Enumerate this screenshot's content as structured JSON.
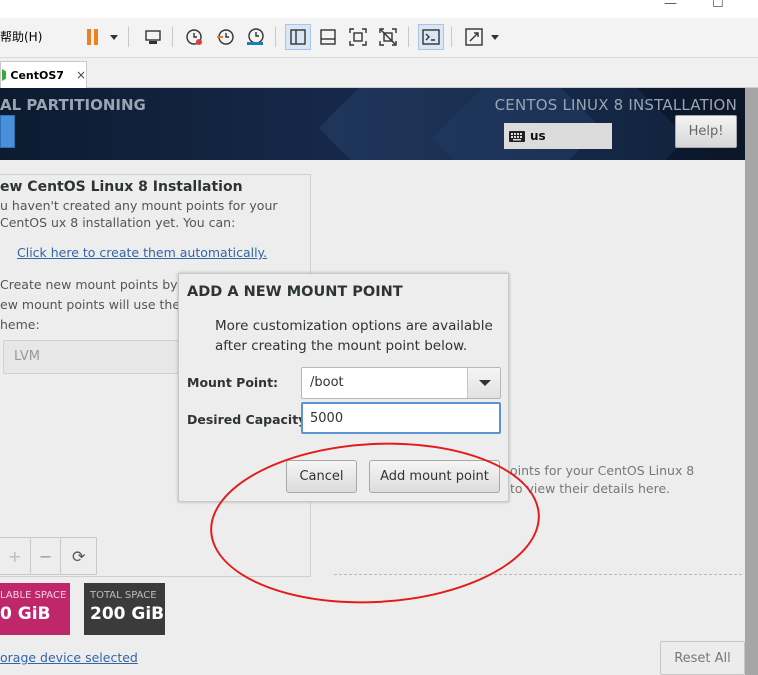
{
  "host": {
    "help_menu": "帮助(H)",
    "tab": {
      "label": "CentOS7",
      "close": "×"
    },
    "window_controls": {
      "minimize": "—",
      "maximize": "☐"
    }
  },
  "vm_header": {
    "left_title": "AL PARTITIONING",
    "right_title": "CENTOS LINUX 8 INSTALLATION",
    "keyboard": "us",
    "help_button": "Help!"
  },
  "left_panel": {
    "title": "ew CentOS Linux 8 Installation",
    "message": "u haven't created any mount points for your CentOS ux 8 installation yet.  You can:",
    "auto_link": "Click here to create them automatically.",
    "message2_line1": "Create new mount points by cl",
    "message2_line2": "ew mount points will use the fo",
    "message2_line3": "heme:",
    "scheme": "LVM",
    "add_symbol": "+",
    "remove_symbol": "−",
    "refresh_symbol": "⟳"
  },
  "space": {
    "available_label": "LABLE SPACE",
    "available_value": "0 GiB",
    "total_label": "TOTAL SPACE",
    "total_value": "200 GiB"
  },
  "storage_link": "orage device selected",
  "right_panel": {
    "line1": "oints for your CentOS Linux 8",
    "line2": "to view their details here.",
    "reset_button": "Reset All"
  },
  "dialog": {
    "title": "ADD A NEW MOUNT POINT",
    "message": "More customization options are available after creating the mount point below.",
    "mount_point_label": "Mount Point:",
    "mount_point_value": "/boot",
    "capacity_label": "Desired Capacity:",
    "capacity_value": "5000",
    "cancel_button": "Cancel",
    "add_button": "Add mount point"
  },
  "colors": {
    "accent_blue": "#4a90d9",
    "available_space_bg": "#c0276b",
    "total_space_bg": "#3b3b3b",
    "annotation_red": "#e21b1b"
  }
}
